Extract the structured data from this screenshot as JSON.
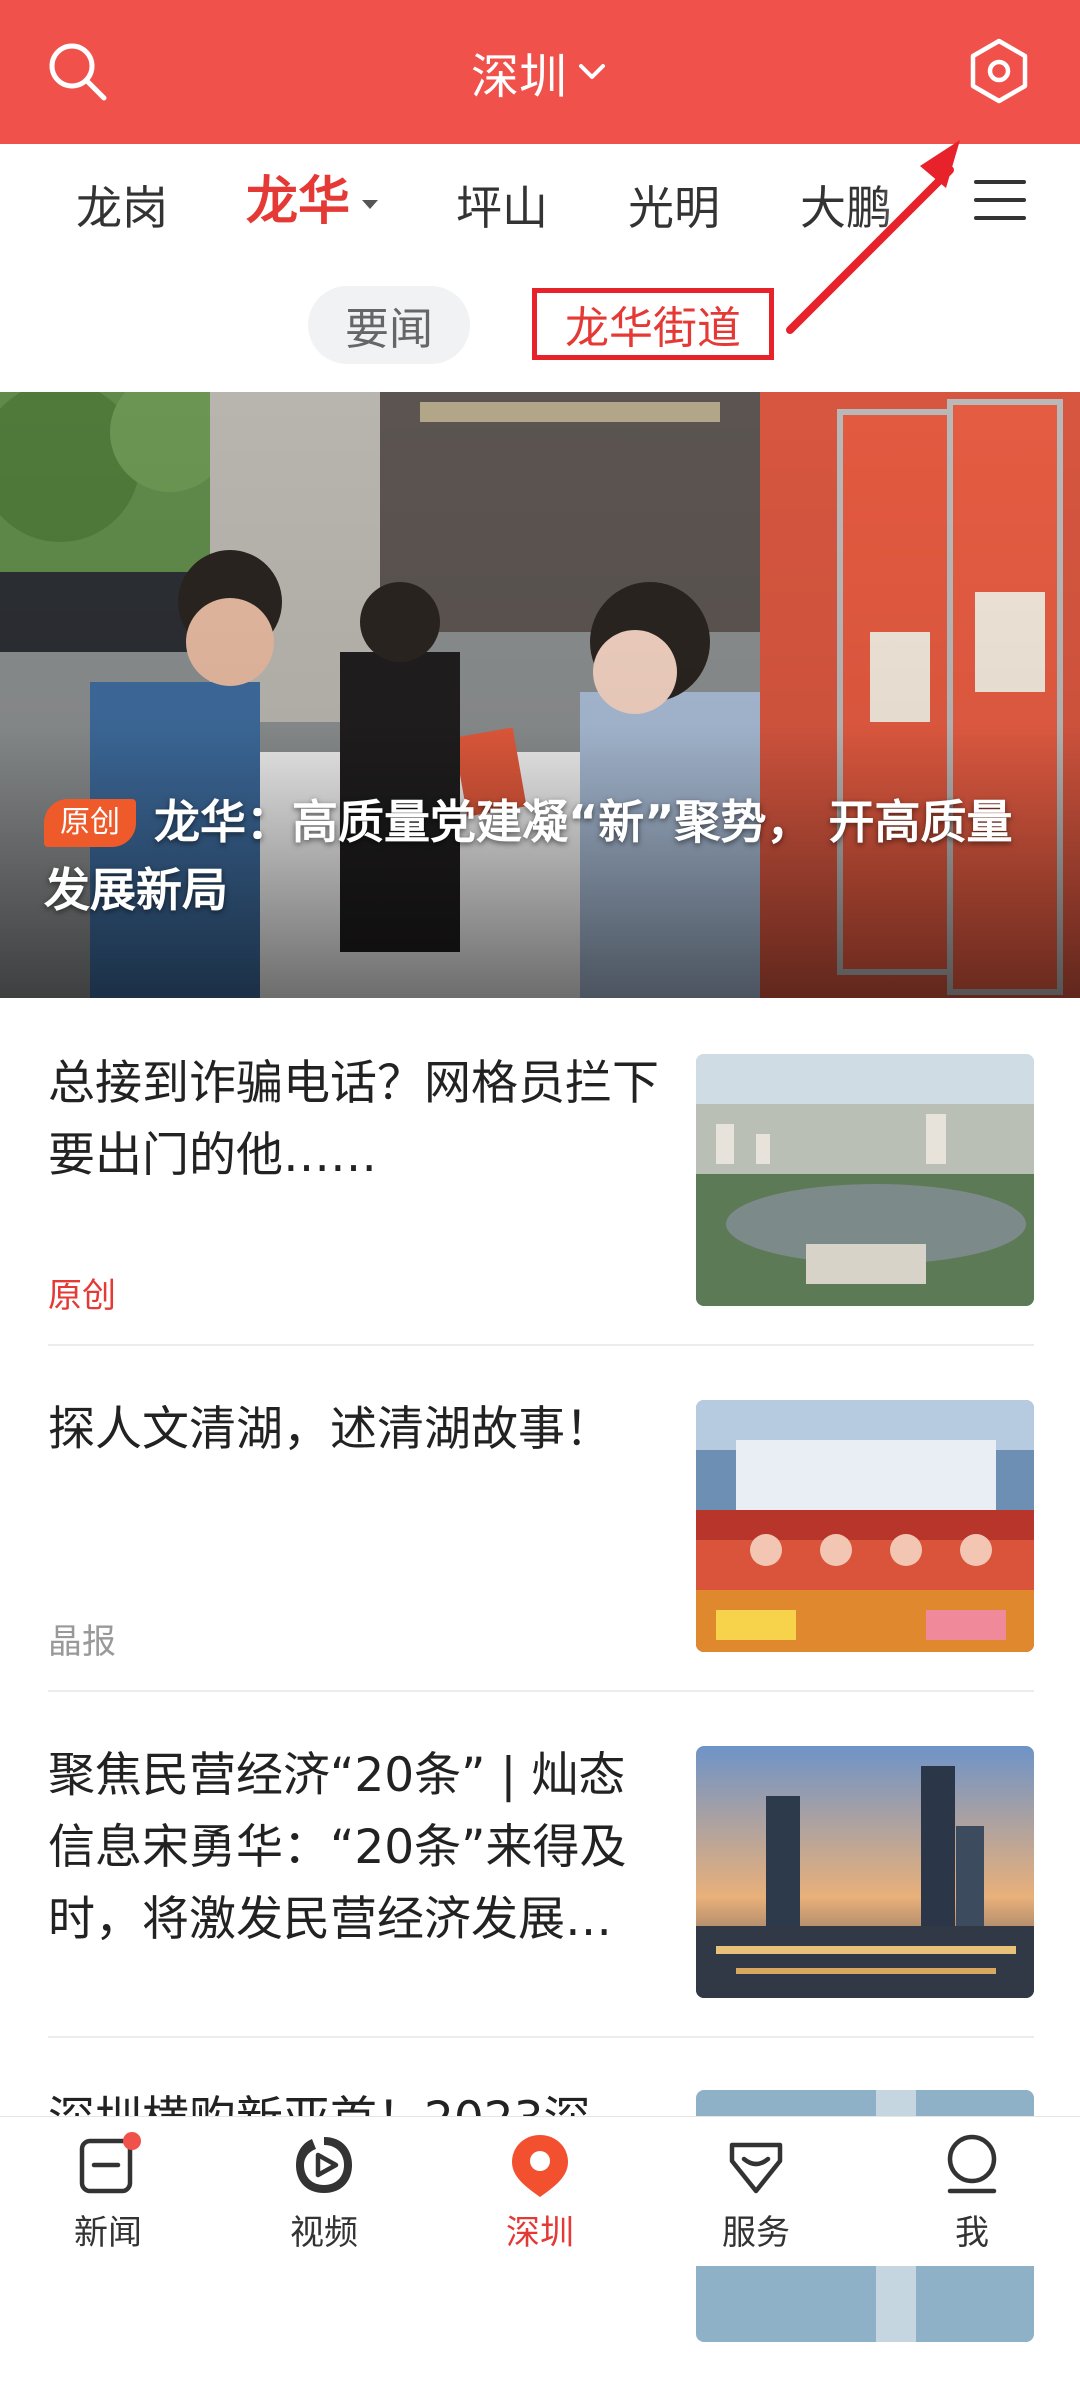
{
  "header": {
    "city": "深圳",
    "search_icon": "search-icon",
    "settings_icon": "hexagon-settings-icon"
  },
  "channels": {
    "items": [
      "龙岗",
      "龙华",
      "坪山",
      "光明",
      "大鹏"
    ],
    "active": "龙华",
    "menu_icon": "menu-icon"
  },
  "subtabs": {
    "items": [
      "要闻",
      "龙华街道"
    ],
    "active": "龙华街道"
  },
  "hero": {
    "badge": "原创",
    "title": "龙华：高质量党建凝“新”聚势， 开高质量发展新局"
  },
  "articles": [
    {
      "title": "总接到诈骗电话？网格员拦下要出门的他……",
      "source": "原创"
    },
    {
      "title": "探人文清湖，述清湖故事！",
      "source": "晶报"
    },
    {
      "title": "聚焦民营经济“20条” | 灿态信息宋勇华：“20条”来得及时，将激发民营经济发展…",
      "source": ""
    },
    {
      "title": "深圳横购新亚首！2023深",
      "source": ""
    }
  ],
  "bottom_nav": [
    {
      "label": "新闻",
      "icon": "news-icon"
    },
    {
      "label": "视频",
      "icon": "video-icon"
    },
    {
      "label": "深圳",
      "icon": "location-pin-icon"
    },
    {
      "label": "服务",
      "icon": "service-icon"
    },
    {
      "label": "我",
      "icon": "profile-icon"
    }
  ],
  "colors": {
    "brand_red": "#f0514b",
    "accent_red": "#e53935",
    "annotation_red": "#e8222a"
  }
}
